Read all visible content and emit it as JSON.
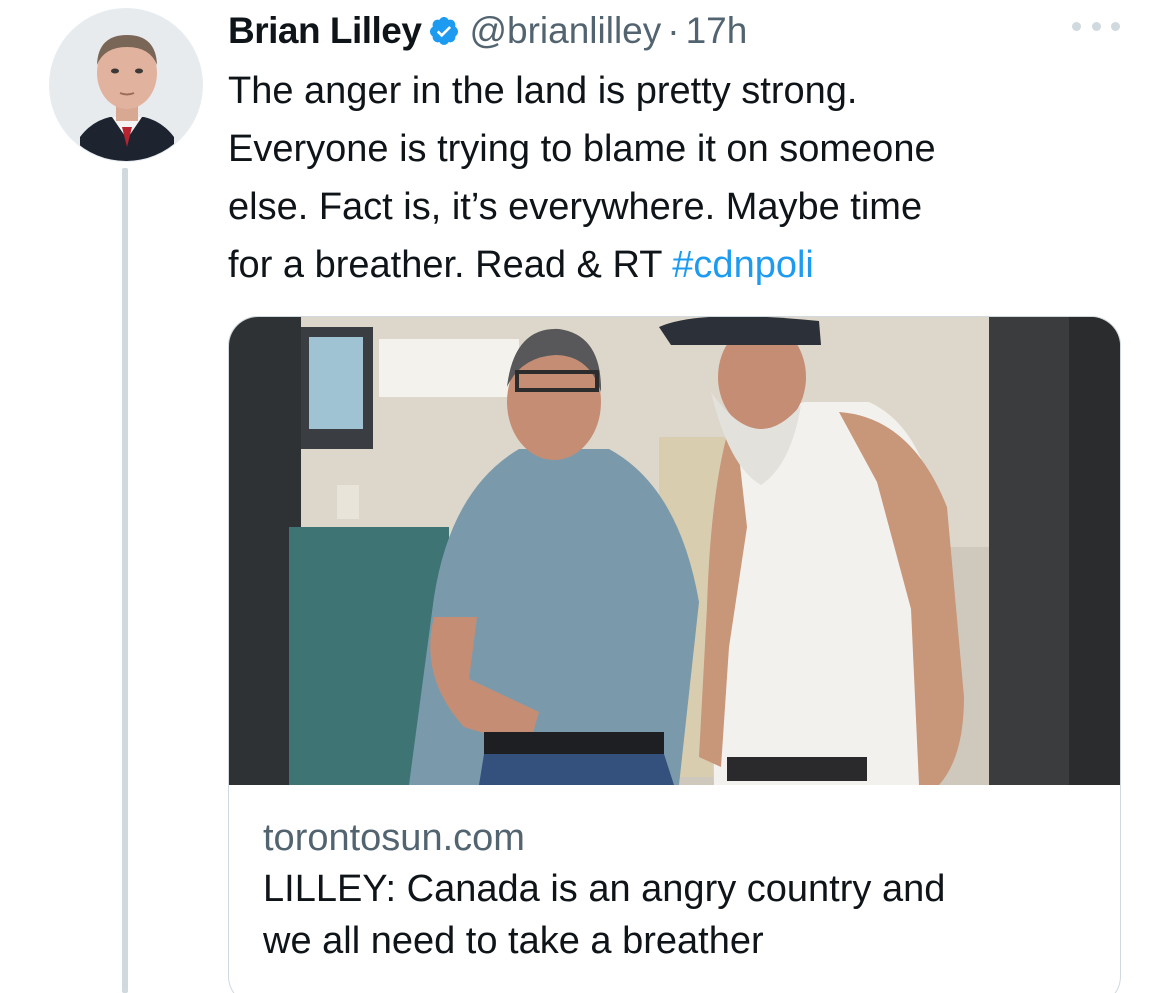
{
  "tweet": {
    "author_name": "Brian Lilley",
    "verified": true,
    "handle": "@brianlilley",
    "separator": "·",
    "time": "17h",
    "text_lines": [
      "The anger in the land is pretty strong.",
      "Everyone is trying to blame it on someone",
      "else. Fact is, it’s everywhere. Maybe time",
      "for a breather. Read & RT "
    ],
    "hashtag": "#cdnpoli"
  },
  "card": {
    "domain": "torontosun.com",
    "title_lines": [
      "LILLEY: Canada is an angry country and",
      "we all need to take a breather"
    ]
  },
  "icons": {
    "verified": "verified-badge-icon",
    "more": "more-options-icon"
  },
  "colors": {
    "link": "#1d9bf0",
    "secondary_text": "#536471",
    "thread_line": "#cfd9de",
    "verified_badge": "#1d9bf0"
  }
}
